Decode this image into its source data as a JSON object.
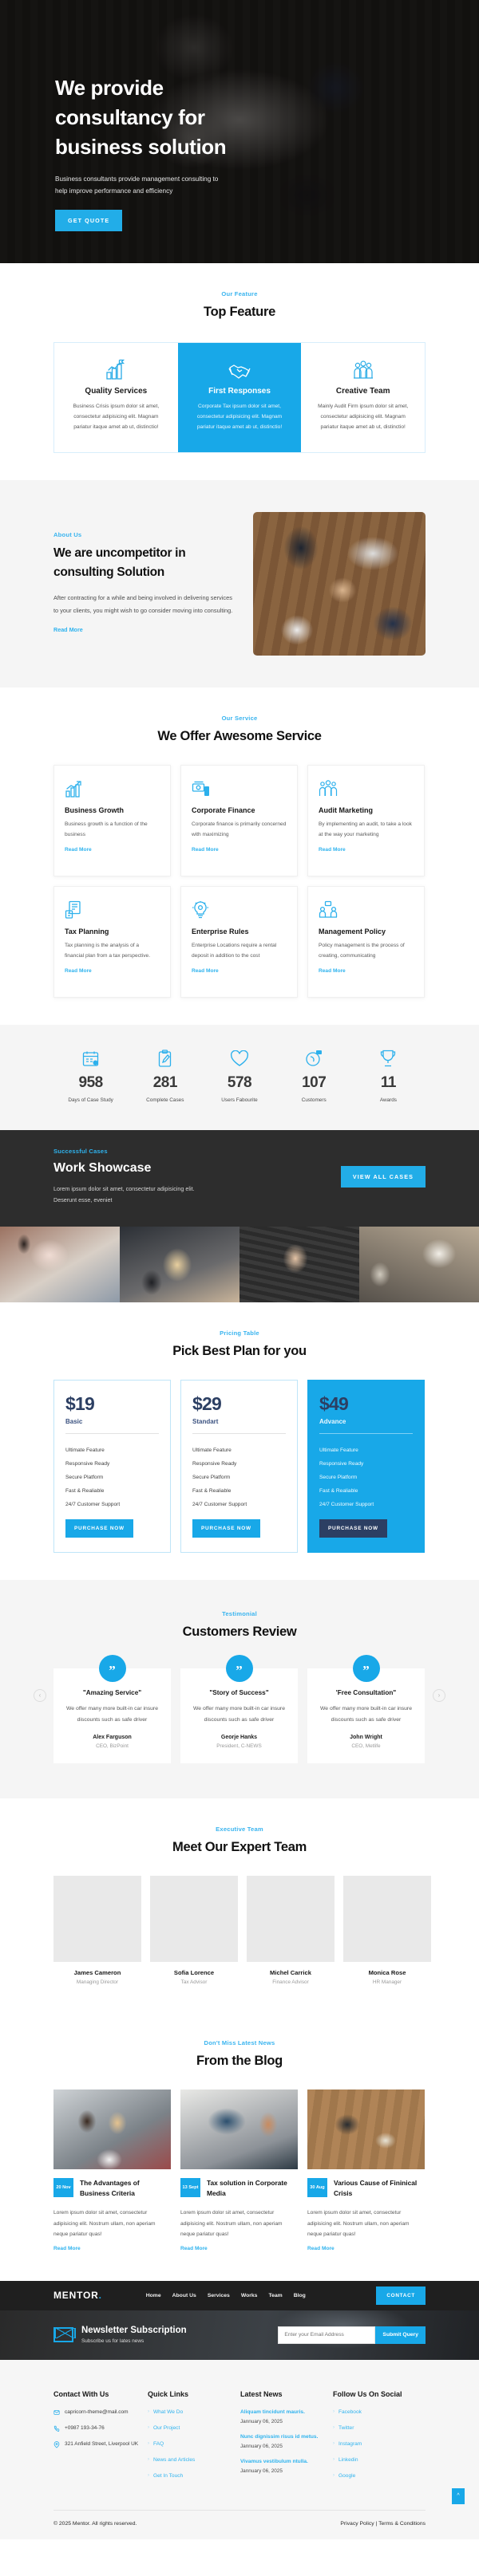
{
  "hero": {
    "title_line1": "We provide",
    "title_line2": "consultancy for",
    "title_line3": "business solution",
    "subtitle": "Business consultants provide management consulting to help improve performance and efficiency",
    "cta": "GET QUOTE"
  },
  "feature_section": {
    "eyebrow": "Our Feature",
    "title": "Top Feature",
    "items": [
      {
        "icon": "growth-flag-icon",
        "title": "Quality Services",
        "text": "Business Crisis ipsum dolor sit amet, consectetur adipisicing elit. Magnam pariatur itaque amet ab ut, distinctio!"
      },
      {
        "icon": "handshake-icon",
        "title": "First Responses",
        "text": "Corporate Tax ipsum dolor sit amet, consectetur adipisicing elit. Magnam pariatur itaque amet ab ut, distinctio!"
      },
      {
        "icon": "team-people-icon",
        "title": "Creative Team",
        "text": "Mainly Audit Firm ipsum dolor sit amet, consectetur adipisicing elit. Magnam pariatur itaque amet ab ut, distinctio!"
      }
    ]
  },
  "about": {
    "eyebrow": "About Us",
    "title_line1": "We are uncompetitor in",
    "title_line2": "consulting Solution",
    "text": "After contracting for a while and being involved in delivering services to your clients, you might wish to go consider moving into consulting.",
    "link": "Read More"
  },
  "services": {
    "eyebrow": "Our Service",
    "title": "We Offer Awesome Service",
    "link_label": "Read More",
    "items": [
      {
        "icon": "bar-chart-growth-icon",
        "title": "Business Growth",
        "text": "Business growth is a function of the business"
      },
      {
        "icon": "money-cash-icon",
        "title": "Corporate Finance",
        "text": "Corporate finance is primarily concerned with maximizing"
      },
      {
        "icon": "audit-people-icon",
        "title": "Audit Marketing",
        "text": "By implementing an audit, to take a look at the way your marketing"
      },
      {
        "icon": "tax-document-icon",
        "title": "Tax Planning",
        "text": "Tax planning is the analysis of a financial plan from a tax perspective."
      },
      {
        "icon": "lightbulb-gear-icon",
        "title": "Enterprise Rules",
        "text": "Enterprise Locations require a rental deposit in addition to the cost"
      },
      {
        "icon": "management-meeting-icon",
        "title": "Management Policy",
        "text": "Policy management is the process of creating, communicating"
      }
    ]
  },
  "counters": [
    {
      "icon": "calendar-icon",
      "value": "958",
      "label": "Days of Case Study"
    },
    {
      "icon": "clipboard-pen-icon",
      "value": "281",
      "label": "Complete Cases"
    },
    {
      "icon": "heart-icon",
      "value": "578",
      "label": "Users Fabourite"
    },
    {
      "icon": "customers-icon",
      "value": "107",
      "label": "Customers"
    },
    {
      "icon": "trophy-icon",
      "value": "11",
      "label": "Awards"
    }
  ],
  "work": {
    "eyebrow": "Successful Cases",
    "title": "Work Showcase",
    "text": "Lorem ipsum dolor sit amet, consectetur adipisicing elit. Deserunt esse, eveniet",
    "cta": "VIEW ALL CASES"
  },
  "pricing": {
    "eyebrow": "Pricing Table",
    "title": "Pick Best Plan for you",
    "plans": [
      {
        "amount": "$19",
        "plan": "Basic",
        "features": [
          "Ultimate Feature",
          "Responsive Ready",
          "Secure Platform",
          "Fast & Realiable",
          "24/7 Customer Support"
        ],
        "cta": "PURCHASE NOW",
        "popular": false
      },
      {
        "amount": "$29",
        "plan": "Standart",
        "features": [
          "Ultimate Feature",
          "Responsive Ready",
          "Secure Platform",
          "Fast & Realiable",
          "24/7 Customer Support"
        ],
        "cta": "PURCHASE NOW",
        "popular": false
      },
      {
        "amount": "$49",
        "plan": "Advance",
        "features": [
          "Ultimate Feature",
          "Responsive Ready",
          "Secure Platform",
          "Fast & Realiable",
          "24/7 Customer Support"
        ],
        "cta": "PURCHASE NOW",
        "popular": true
      }
    ]
  },
  "testimonials": {
    "eyebrow": "Testimonial",
    "title": "Customers Review",
    "prev_icon": "chevron-left-icon",
    "next_icon": "chevron-right-icon",
    "items": [
      {
        "quote_mark": "”",
        "heading": "\"Amazing Service\"",
        "text": "We offer many more built-in car insure discounts such as safe driver",
        "name": "Alex Farguson",
        "role": "CEO, BizPoint"
      },
      {
        "quote_mark": "”",
        "heading": "\"Story of Success\"",
        "text": "We offer many more built-in car insure discounts such as safe driver",
        "name": "Georje Hanks",
        "role": "President, C-NEWS"
      },
      {
        "quote_mark": "”",
        "heading": "'Free Consultation\"",
        "text": "We offer many more built-in car insure discounts such as safe driver",
        "name": "John Wright",
        "role": "CEO, Metlife"
      }
    ]
  },
  "team": {
    "eyebrow": "Executive Team",
    "title": "Meet Our Expert Team",
    "members": [
      {
        "name": "James Cameron",
        "role": "Managing Director"
      },
      {
        "name": "Sofia Lorence",
        "role": "Tax Advisor"
      },
      {
        "name": "Michel Carrick",
        "role": "Finance Advisor"
      },
      {
        "name": "Monica Rose",
        "role": "HR Manager"
      }
    ]
  },
  "blog": {
    "eyebrow": "Don't Miss Latest News",
    "title": "From the Blog",
    "link_label": "Read More",
    "posts": [
      {
        "date": "20 Nov",
        "title": "The Advantages of Business Criteria",
        "text": "Lorem ipsum dolor sit amet, consectetur adipisicing elit. Nostrum ullam, non aperiam neque pariatur quas!"
      },
      {
        "date": "13 Sept",
        "title": "Tax solution in Corporate Media",
        "text": "Lorem ipsum dolor sit amet, consectetur adipisicing elit. Nostrum ullam, non aperiam neque pariatur quas!"
      },
      {
        "date": "30 Aug",
        "title": "Various Cause of Fininical Crisis",
        "text": "Lorem ipsum dolor sit amet, consectetur adipisicing elit. Nostrum ullam, non aperiam neque pariatur quas!"
      }
    ]
  },
  "footer_nav": {
    "logo": "MENTOR",
    "logo_dot": ".",
    "links": [
      "Home",
      "About Us",
      "Services",
      "Works",
      "Team",
      "Blog"
    ],
    "contact_cta": "CONTACT"
  },
  "newsletter": {
    "icon": "envelope-icon",
    "title": "Newsletter Subscription",
    "subtitle": "Subscribe us for lates news",
    "placeholder": "Enter your Email Address",
    "submit": "Submit Query"
  },
  "footer": {
    "contact": {
      "heading": "Contact With Us",
      "email": "capricorn-theme@mail.com",
      "phone": "+0987 193-34-76",
      "address": "321 Anfield Street, Liverpool UK",
      "email_icon": "mail-icon",
      "phone_icon": "phone-icon",
      "address_icon": "map-pin-icon"
    },
    "quick_links": {
      "heading": "Quick Links",
      "items": [
        "What We Do",
        "Our Project",
        "FAQ",
        "News and Articles",
        "Get In Touch"
      ]
    },
    "latest_news": {
      "heading": "Latest News",
      "items": [
        {
          "title": "Aliquam tincidunt mauris.",
          "date": "Jannuary 06, 2025"
        },
        {
          "title": "Nunc dignissim risus id metus.",
          "date": "Jannuary 06, 2025"
        },
        {
          "title": "Vivamus vestibulum ntulla.",
          "date": "Jannuary 06, 2025"
        }
      ]
    },
    "social": {
      "heading": "Follow Us On Social",
      "items": [
        "Facebook",
        "Twitter",
        "Instagram",
        "Linkedin",
        "Google"
      ]
    },
    "copyright": "© 2025 Mentor. All rights reserved.",
    "legal": "Privacy Policy | Terms & Conditions",
    "to_top_icon": "chevron-up-icon"
  },
  "colors": {
    "accent": "#18a8e8",
    "dark": "#2d2d2d",
    "light_bg": "#f5f5f5"
  }
}
